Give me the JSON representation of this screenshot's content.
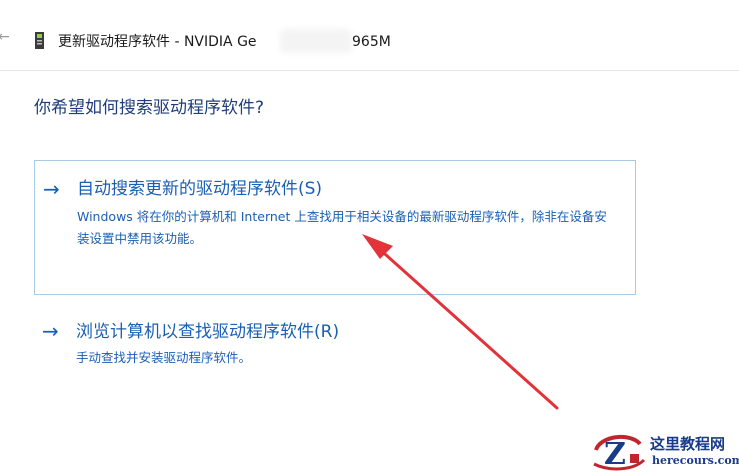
{
  "window": {
    "title": "更新驱动程序软件 - NVIDIA Ge",
    "title_suffix": "965M",
    "back_icon": "back-arrow-icon",
    "device_icon": "display-adapter-icon"
  },
  "main": {
    "question": "你希望如何搜索驱动程序软件?",
    "options": [
      {
        "arrow": "→",
        "title": "自动搜索更新的驱动程序软件(S)",
        "description": "Windows 将在你的计算机和 Internet 上查找用于相关设备的最新驱动程序软件，除非在设备安装设置中禁用该功能。"
      },
      {
        "arrow": "→",
        "title": "浏览计算机以查找驱动程序软件(R)",
        "description": "手动查找并安装驱动程序软件。"
      }
    ]
  },
  "colors": {
    "accent": "#1a5fb4",
    "question": "#1f3d7a",
    "annotation": "#e2323a"
  },
  "watermark": {
    "title": "这里教程网",
    "url": "herecours.com"
  }
}
